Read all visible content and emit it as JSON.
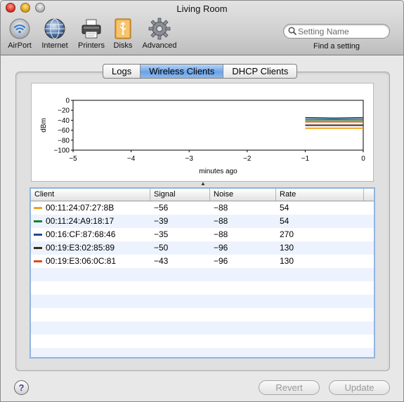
{
  "window": {
    "title": "Living Room"
  },
  "toolbar": {
    "items": [
      {
        "label": "AirPort",
        "icon": "airport-icon"
      },
      {
        "label": "Internet",
        "icon": "globe-icon"
      },
      {
        "label": "Printers",
        "icon": "printer-icon"
      },
      {
        "label": "Disks",
        "icon": "usb-disk-icon"
      },
      {
        "label": "Advanced",
        "icon": "gear-icon"
      }
    ],
    "search": {
      "placeholder": "Setting Name",
      "caption": "Find a setting"
    }
  },
  "tabs": [
    {
      "label": "Logs",
      "selected": false
    },
    {
      "label": "Wireless Clients",
      "selected": true
    },
    {
      "label": "DHCP Clients",
      "selected": false
    }
  ],
  "chart_data": {
    "type": "line",
    "xlabel": "minutes ago",
    "ylabel": "dBm",
    "xlim": [
      -5,
      0
    ],
    "ylim": [
      -100,
      0
    ],
    "x_ticks": [
      "−5",
      "−4",
      "−3",
      "−2",
      "−1",
      "0"
    ],
    "y_ticks": [
      "0",
      "−20",
      "−40",
      "−60",
      "−80",
      "−100"
    ],
    "grid": false,
    "series": [
      {
        "color": "#f0a21a",
        "x": [
          -1,
          -0.5,
          0
        ],
        "values": [
          -56,
          -56,
          -56
        ]
      },
      {
        "color": "#1b7f2e",
        "x": [
          -1,
          -0.5,
          0
        ],
        "values": [
          -39,
          -39,
          -39
        ]
      },
      {
        "color": "#1d4f8c",
        "x": [
          -1,
          -0.5,
          0
        ],
        "values": [
          -35,
          -36,
          -35
        ]
      },
      {
        "color": "#3e2a18",
        "x": [
          -1,
          -0.5,
          0
        ],
        "values": [
          -50,
          -50,
          -50
        ]
      },
      {
        "color": "#e04a1c",
        "x": [
          -1,
          -0.5,
          0
        ],
        "values": [
          -43,
          -43,
          -43
        ]
      }
    ]
  },
  "table": {
    "columns": [
      "Client",
      "Signal",
      "Noise",
      "Rate"
    ],
    "rows": [
      {
        "color": "#f0a21a",
        "client": "00:11:24:07:27:8B",
        "signal": "−56",
        "noise": "−88",
        "rate": "54"
      },
      {
        "color": "#1b7f2e",
        "client": "00:11:24:A9:18:17",
        "signal": "−39",
        "noise": "−88",
        "rate": "54"
      },
      {
        "color": "#1d4f8c",
        "client": "00:16:CF:87:68:46",
        "signal": "−35",
        "noise": "−88",
        "rate": "270"
      },
      {
        "color": "#3e2a18",
        "client": "00:19:E3:02:85:89",
        "signal": "−50",
        "noise": "−96",
        "rate": "130"
      },
      {
        "color": "#e04a1c",
        "client": "00:19:E3:06:0C:81",
        "signal": "−43",
        "noise": "−96",
        "rate": "130"
      }
    ],
    "empty_rows": 7
  },
  "footer": {
    "help_label": "?",
    "revert_label": "Revert",
    "update_label": "Update"
  }
}
